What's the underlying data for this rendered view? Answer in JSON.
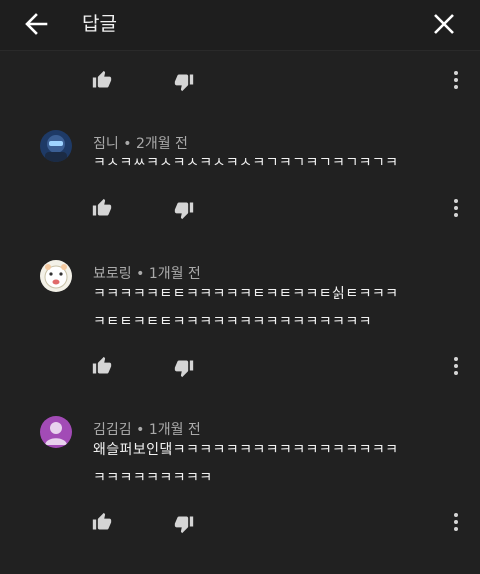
{
  "header": {
    "title": "답글",
    "back_icon": "arrow-left-icon",
    "close_icon": "close-icon"
  },
  "comments": [
    {
      "author": "짐니",
      "time": "2개월 전",
      "lines": [
        "ㅋㅅㅋㅆㅋㅅㅋㅅㅋㅅㅋㅅㅋㄱㅋㄱㅋㄱㅋㄱㅋㄱㅋ"
      ]
    },
    {
      "author": "뵤로링",
      "time": "1개월 전",
      "lines": [
        "ㅋㅋㅋㅋㅋㅌㅌㅋㅋㅋㅋㅋㅌㅋㅌㅋㅋㅌ싥ㅌㅋㅋㅋ",
        "ㅋㅌㅌㅋㅌㅌㅋㅋㅋㅋㅋㅋㅋㅋㅋㅋㅋㅋㅋㅋㅋ"
      ]
    },
    {
      "author": "김김김",
      "time": "1개월 전",
      "lines": [
        "왜슬퍼보인댘ㅋㅋㅋㅋㅋㅋㅋㅋㅋㅋㅋㅋㅋㅋㅋㅋㅋ",
        "ㅋㅋㅋㅋㅋㅋㅋㅋㅋ"
      ]
    }
  ],
  "separator": "•",
  "icons": {
    "like": "thumbs-up-icon",
    "dislike": "thumbs-down-icon",
    "more": "more-vertical-icon"
  },
  "colors": {
    "background": "#212121",
    "header": "#1e1e1e",
    "text": "#f1f1f1",
    "meta_text": "#aaaaaa",
    "icon": "#d5d5d5"
  }
}
